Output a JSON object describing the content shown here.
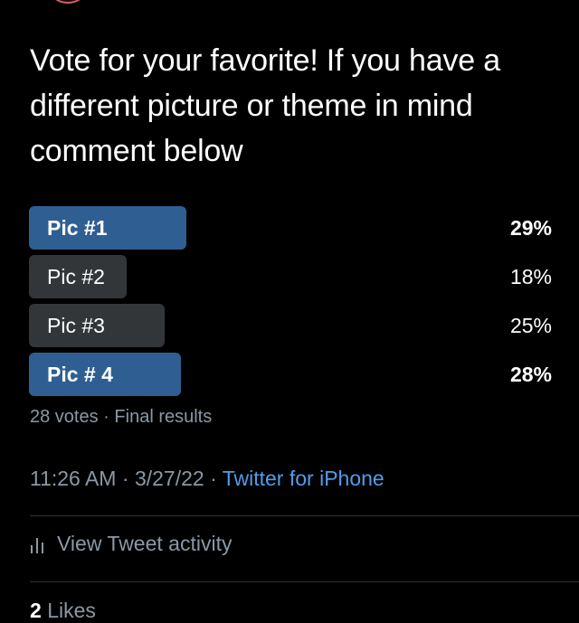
{
  "tweet": {
    "text": "Vote for your favorite! If you have a different picture or theme in mind comment below"
  },
  "poll": {
    "options": [
      {
        "label": "Pic #1",
        "percent": "29%",
        "value": 29,
        "winner": true
      },
      {
        "label": "Pic #2",
        "percent": "18%",
        "value": 18,
        "winner": false
      },
      {
        "label": "Pic #3",
        "percent": "25%",
        "value": 25,
        "winner": false
      },
      {
        "label": "Pic # 4",
        "percent": "28%",
        "value": 28,
        "winner": true
      }
    ],
    "votes": "28 votes",
    "separator": "·",
    "status": "Final results"
  },
  "meta": {
    "time": "11:26 AM",
    "date": "3/27/22",
    "separator": "·",
    "source": "Twitter for iPhone"
  },
  "activity": {
    "label": "View Tweet activity",
    "icon": "analytics-bars-icon"
  },
  "likes": {
    "count": "2",
    "label": "Likes"
  },
  "colors": {
    "background": "#000000",
    "winner_bar": "#2f5f92",
    "other_bar": "#333639",
    "secondary_text": "#8b98a5",
    "link": "#4f9de9",
    "divider": "#2f3336"
  }
}
